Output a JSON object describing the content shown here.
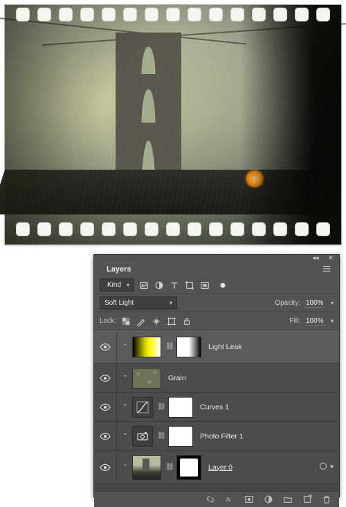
{
  "panel": {
    "title": "Layers",
    "filter": {
      "kind_label": "Kind"
    },
    "blend": {
      "mode": "Soft Light",
      "opacity_label": "Opacity:",
      "opacity_value": "100%"
    },
    "lock": {
      "label": "Lock:",
      "fill_label": "Fill:",
      "fill_value": "100%"
    },
    "layers": [
      {
        "name": "Light Leak"
      },
      {
        "name": "Grain"
      },
      {
        "name": "Curves 1"
      },
      {
        "name": "Photo Filter 1"
      },
      {
        "name": "Layer 0"
      }
    ]
  }
}
